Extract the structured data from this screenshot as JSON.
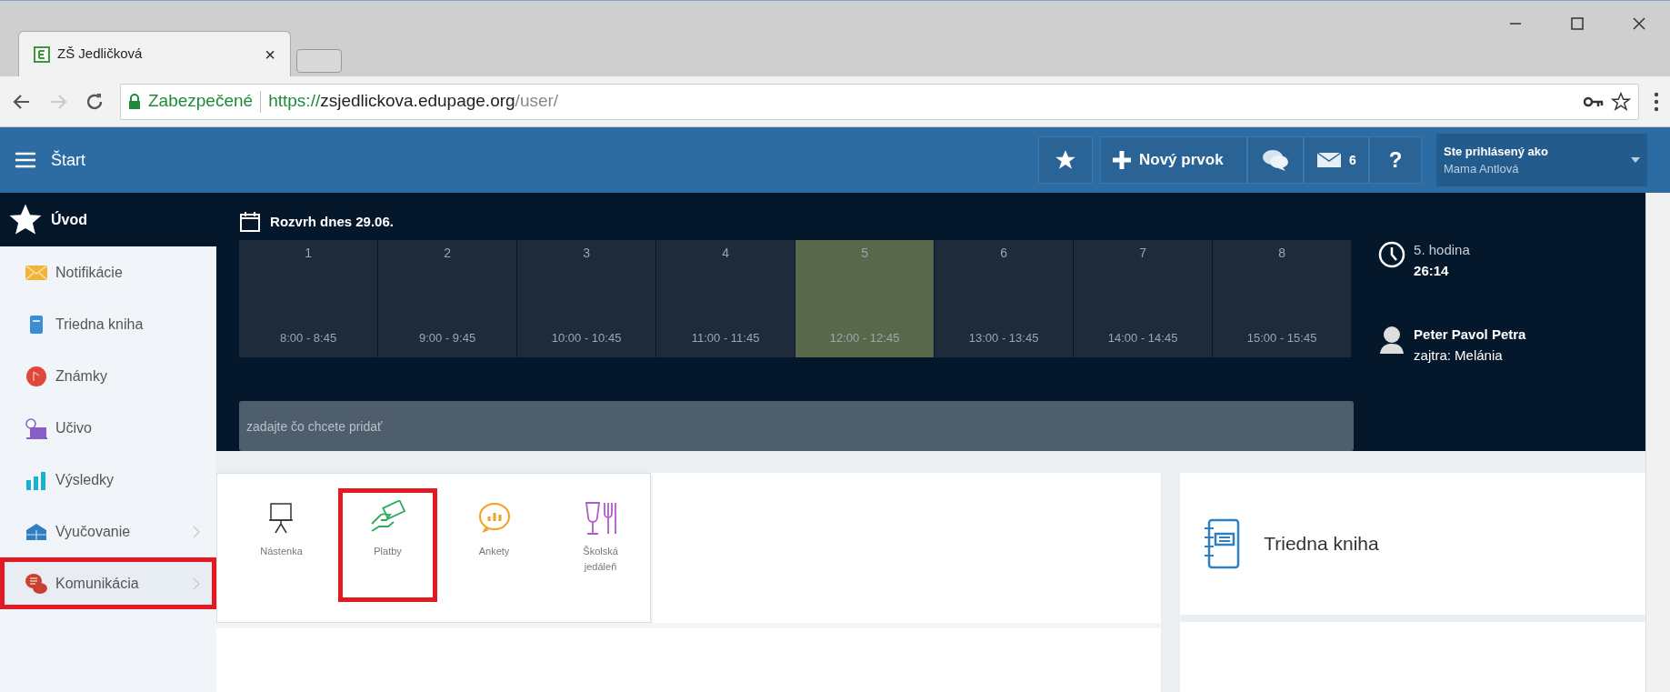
{
  "browser": {
    "tab_title": "ZŠ Jedličková",
    "tab_close": "×",
    "secure_label": "Zabezpečené",
    "url_scheme": "https://",
    "url_host": "zsjedlickova.edupage.org",
    "url_path": "/user/"
  },
  "topbar": {
    "start_label": "Štart",
    "new_item": "Nový prvok",
    "messages_count": "6",
    "help": "?",
    "user_caption": "Ste prihlásený ako",
    "user_name": "Mama Antlová"
  },
  "sidebar": {
    "header": "Úvod",
    "items": [
      {
        "label": "Notifikácie",
        "kind": "envelope",
        "has_submenu": false,
        "highlighted": false
      },
      {
        "label": "Triedna kniha",
        "kind": "book",
        "has_submenu": false,
        "highlighted": false
      },
      {
        "label": "Známky",
        "kind": "grade",
        "has_submenu": false,
        "highlighted": false
      },
      {
        "label": "Učivo",
        "kind": "lesson",
        "has_submenu": false,
        "highlighted": false
      },
      {
        "label": "Výsledky",
        "kind": "chart",
        "has_submenu": false,
        "highlighted": false
      },
      {
        "label": "Vyučovanie",
        "kind": "school",
        "has_submenu": true,
        "highlighted": false
      },
      {
        "label": "Komunikácia",
        "kind": "chat",
        "has_submenu": true,
        "highlighted": true
      }
    ]
  },
  "timetable": {
    "title": "Rozvrh dnes 29.06.",
    "periods": [
      {
        "number": "1",
        "time": "8:00 - 8:45",
        "selected": false
      },
      {
        "number": "2",
        "time": "9:00 - 9:45",
        "selected": false
      },
      {
        "number": "3",
        "time": "10:00 - 10:45",
        "selected": false
      },
      {
        "number": "4",
        "time": "11:00 - 11:45",
        "selected": false
      },
      {
        "number": "5",
        "time": "12:00 - 12:45",
        "selected": true
      },
      {
        "number": "6",
        "time": "13:00 - 13:45",
        "selected": false
      },
      {
        "number": "7",
        "time": "14:00 - 14:45",
        "selected": false
      },
      {
        "number": "8",
        "time": "15:00 - 15:45",
        "selected": false
      }
    ]
  },
  "add_field": {
    "placeholder": "zadajte čo chcete pridať"
  },
  "current": {
    "period": "5. hodina",
    "remaining": "26:14"
  },
  "nameday": {
    "today": "Peter Pavol Petra",
    "tomorrow": "zajtra: Melánia"
  },
  "apps": [
    {
      "label": "Nástenka",
      "kind": "board",
      "highlighted": false
    },
    {
      "label": "Platby",
      "kind": "payment",
      "highlighted": true
    },
    {
      "label": "Ankety",
      "kind": "poll",
      "highlighted": false
    },
    {
      "label": "Školská jedáleň",
      "kind": "canteen",
      "highlighted": false
    }
  ],
  "shortcut_card": {
    "label": "Triedna kniha"
  }
}
